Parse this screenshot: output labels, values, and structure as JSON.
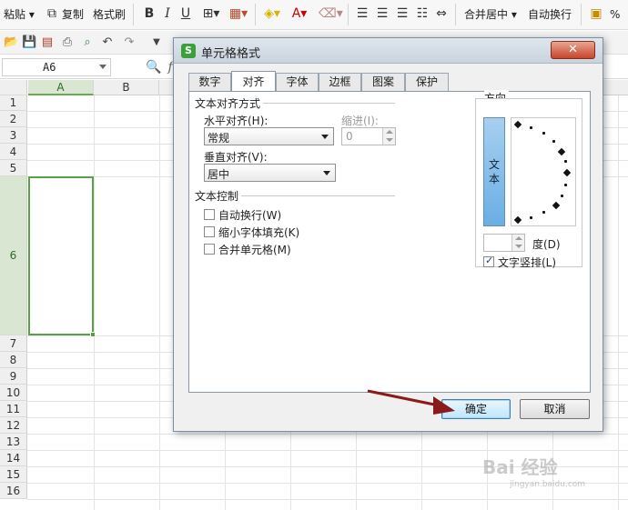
{
  "ribbon": {
    "paste": "粘贴",
    "copy": "复制",
    "format_painter": "格式刷",
    "bold": "B",
    "italic": "I",
    "underline": "U",
    "font_color_letter": "A",
    "merge_center": "合并居中",
    "wrap_text": "自动换行",
    "percent": "%"
  },
  "formula_bar": {
    "name_box": "A6",
    "fx": "fx"
  },
  "sheet": {
    "columns": [
      "A",
      "B"
    ],
    "rows": [
      "1",
      "2",
      "3",
      "4",
      "5",
      "6",
      "7",
      "8",
      "9",
      "10",
      "11",
      "12",
      "13",
      "14",
      "15",
      "16"
    ],
    "selected_cell": "A6"
  },
  "dialog": {
    "title": "单元格格式",
    "title_icon": "S",
    "close_label": "✕",
    "tabs": [
      "数字",
      "对齐",
      "字体",
      "边框",
      "图案",
      "保护"
    ],
    "active_tab": "对齐",
    "text_alignment": {
      "group_label": "文本对齐方式",
      "horizontal_label": "水平对齐(H):",
      "horizontal_value": "常规",
      "indent_label": "缩进(I):",
      "indent_value": "0",
      "vertical_label": "垂直对齐(V):",
      "vertical_value": "居中"
    },
    "text_control": {
      "group_label": "文本控制",
      "wrap_text": {
        "label": "自动换行(W)",
        "checked": false
      },
      "shrink_to_fit": {
        "label": "缩小字体填充(K)",
        "checked": false
      },
      "merge_cells": {
        "label": "合并单元格(M)",
        "checked": false
      }
    },
    "orientation": {
      "group_label": "方向",
      "vertical_text_chars": [
        "文",
        "本"
      ],
      "degree_label": "度(D)",
      "vertical_text_label": "文字竖排(L)",
      "vertical_text_checked": true
    },
    "ok_label": "确定",
    "cancel_label": "取消"
  },
  "watermark": {
    "main": "Bai 经验",
    "sub": "jingyan.baidu.com"
  },
  "colors": {
    "accent_green": "#5aa046",
    "close_red": "#c7452b",
    "arrow": "#8b1a1a"
  }
}
